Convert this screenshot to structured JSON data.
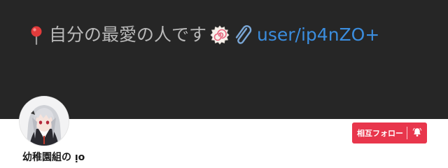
{
  "banner": {
    "bio_text": "自分の最愛の人です",
    "link_text": "user/ip4nZO+"
  },
  "profile": {
    "display_name": "幼稚園組の ᴉᴏ"
  },
  "actions": {
    "follow_label": "相互フォロー"
  },
  "icons": {
    "pin": "round-pushpin-icon",
    "swirl": "fish-cake-swirl-icon",
    "clip": "paperclip-icon",
    "bell": "bell-icon"
  },
  "colors": {
    "banner_bg": "#262626",
    "banner_text": "#b9b9b9",
    "link": "#3b8dde",
    "follow_button": "#e8364c"
  }
}
